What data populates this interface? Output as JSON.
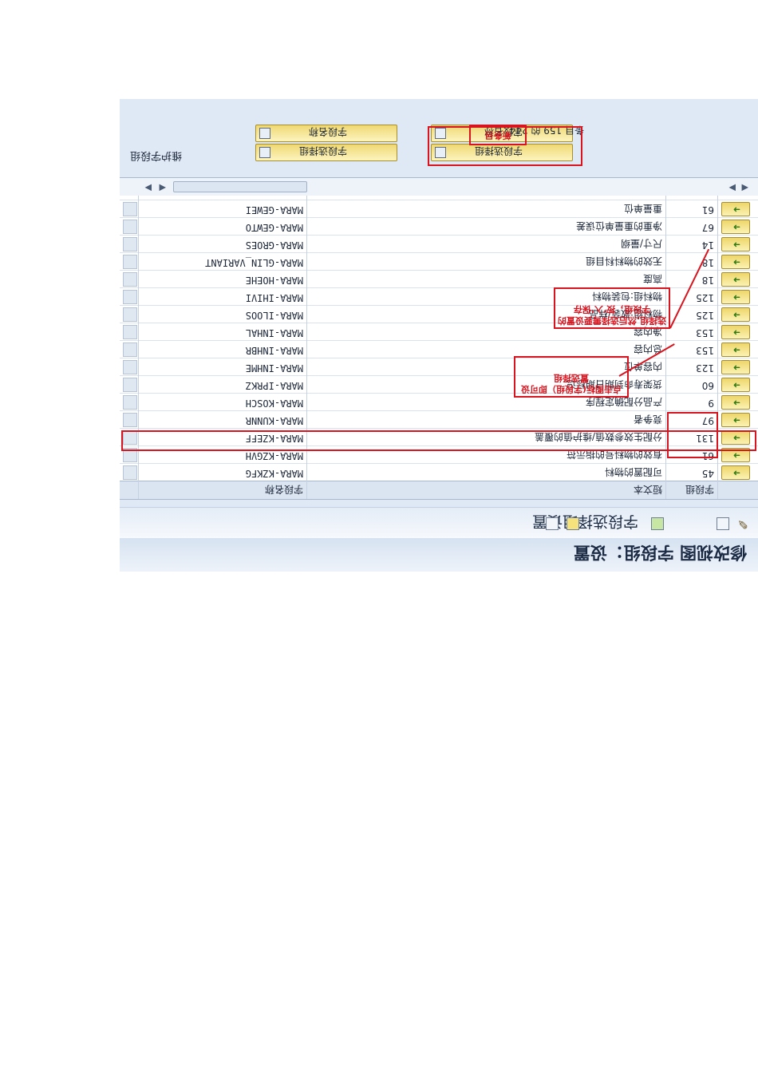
{
  "window": {
    "title": "修改视图 字段组：设置"
  },
  "toolbar": {
    "title": "字段选择组设置"
  },
  "table": {
    "columns": [
      "字段名称",
      "短文本",
      "字段组"
    ],
    "rows": [
      {
        "field": "MARA-GEWEI",
        "desc": "重量单位",
        "group": "61"
      },
      {
        "field": "MARA-GEWTO",
        "desc": "净重的重量单位误差",
        "group": "67"
      },
      {
        "field": "MARA-GROES",
        "desc": "尺寸/量纲",
        "group": "14"
      },
      {
        "field": "MARA-GLIN_VARIANT",
        "desc": "无效的物料科目组",
        "group": "18"
      },
      {
        "field": "MARA-HOEHE",
        "desc": "高度",
        "group": "18"
      },
      {
        "field": "MARA-IHIVI",
        "desc": "物料组:包装物料",
        "group": "125"
      },
      {
        "field": "MARA-ILOOS",
        "desc": "物料组:散装/样品",
        "group": "125"
      },
      {
        "field": "MARA-INHAL",
        "desc": "净内容",
        "group": "153"
      },
      {
        "field": "MARA-INHBR",
        "desc": "总内容",
        "group": "153"
      },
      {
        "field": "MARA-INHME",
        "desc": "内容单位",
        "group": "123"
      },
      {
        "field": "MARA-IPRKZ",
        "desc": "货架寿命到期日期标识",
        "group": "60"
      },
      {
        "field": "MARA-KOSCH",
        "desc": "产品分配确定程序",
        "group": "9"
      },
      {
        "field": "MARA-KUNNR",
        "desc": "竞争者",
        "group": "97"
      },
      {
        "field": "MARA-KZEFF",
        "desc": "分配生效参数值/维护值的覆盖",
        "group": "131"
      },
      {
        "field": "MARA-KZGVH",
        "desc": "有效的物料号的指示符",
        "group": "61"
      },
      {
        "field": "MARA-KZKFG",
        "desc": "可配置的物料",
        "group": "45"
      }
    ]
  },
  "footer": {
    "settings_label": "维护字段组",
    "btn_field_name_1": "字段名称",
    "btn_field_select_1": "字段选择组",
    "btn_field_name_2": "字段名称",
    "btn_field_select_2": "字段选择组",
    "page_info": "条目 159 的 244",
    "new_label": "新条目"
  },
  "annotations": {
    "note1": "点击图标(字段组）即可设置选择组",
    "note2": "选择组,然后选择需要设置的字段组，按‘入’保存"
  },
  "colors": {
    "accent_red": "#d8141e",
    "button_yellow": "#efd872"
  }
}
